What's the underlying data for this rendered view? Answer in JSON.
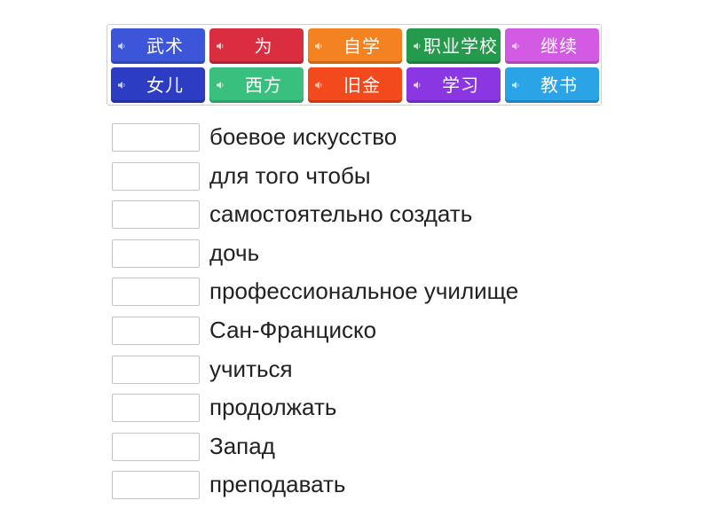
{
  "tiles": [
    {
      "label": "武术",
      "color": "#3d55d9",
      "icon": "speaker-icon"
    },
    {
      "label": "为",
      "color": "#da2d40",
      "icon": "speaker-icon"
    },
    {
      "label": "自学",
      "color": "#f58221",
      "icon": "speaker-icon"
    },
    {
      "label": "职业学校",
      "color": "#259a4c",
      "icon": "speaker-icon"
    },
    {
      "label": "继续",
      "color": "#d35be3",
      "icon": "speaker-icon"
    },
    {
      "label": "女儿",
      "color": "#2c3cc3",
      "icon": "speaker-icon"
    },
    {
      "label": "西方",
      "color": "#39c07e",
      "icon": "speaker-icon"
    },
    {
      "label": "旧金",
      "color": "#f24a1c",
      "icon": "speaker-icon"
    },
    {
      "label": "学习",
      "color": "#8b36e3",
      "icon": "speaker-icon"
    },
    {
      "label": "教书",
      "color": "#2aa4e6",
      "icon": "speaker-icon"
    }
  ],
  "rows": [
    {
      "term": "боевое искусство"
    },
    {
      "term": "для того чтобы"
    },
    {
      "term": "самостоятельно создать"
    },
    {
      "term": "дочь"
    },
    {
      "term": "профессиональное училище"
    },
    {
      "term": "Сан-Франциско"
    },
    {
      "term": "учиться"
    },
    {
      "term": "продолжать"
    },
    {
      "term": "Запад"
    },
    {
      "term": "преподавать"
    }
  ]
}
